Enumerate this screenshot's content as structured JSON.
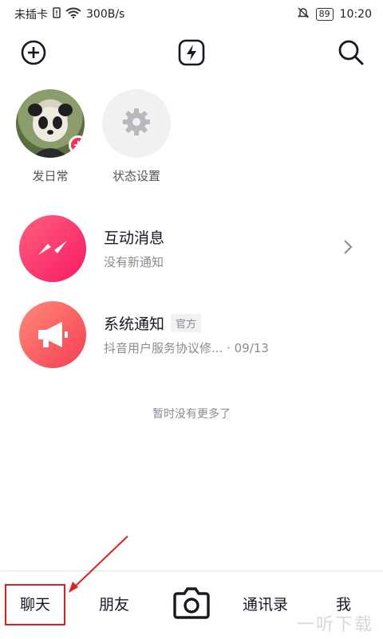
{
  "status_bar": {
    "carrier": "未插卡",
    "speed": "300B/s",
    "battery": "89",
    "time": "10:20"
  },
  "toolbar": {
    "left_icon": "add-circle-icon",
    "center_icon": "lightning-icon",
    "right_icon": "search-icon"
  },
  "stories": [
    {
      "label": "发日常"
    },
    {
      "label": "状态设置"
    }
  ],
  "messages": [
    {
      "title": "互动消息",
      "subtitle": "没有新通知",
      "tag": ""
    },
    {
      "title": "系统通知",
      "tag": "官方",
      "subtitle": "抖音用户服务协议修... · 09/13"
    }
  ],
  "no_more": "暂时没有更多了",
  "nav": {
    "chat": "聊天",
    "friends": "朋友",
    "contacts": "通讯录",
    "me": "我"
  },
  "colors": {
    "accent": "#fe2c55",
    "annotation": "#e0201f"
  },
  "watermark": "一听下载"
}
